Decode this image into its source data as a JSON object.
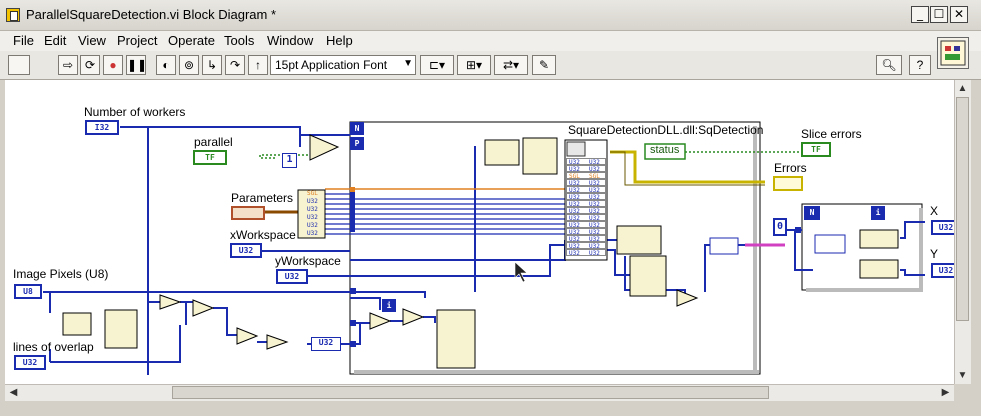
{
  "window": {
    "title": "ParallelSquareDetection.vi Block Diagram *",
    "minimize_glyph": "_",
    "maximize_glyph": "☐",
    "close_glyph": "✕"
  },
  "menu": {
    "items": [
      "File",
      "Edit",
      "View",
      "Project",
      "Operate",
      "Tools",
      "Window",
      "Help"
    ]
  },
  "toolbar": {
    "icons": [
      "run-arrow-icon",
      "run-continuous-icon",
      "abort-icon",
      "pause-icon",
      "highlight-execution-icon",
      "retain-wire-values-icon",
      "step-into-icon",
      "step-over-icon",
      "step-out-icon",
      "align-objects-icon",
      "distribute-objects-icon",
      "reorder-icon",
      "clean-up-diagram-icon",
      "search-icon",
      "context-help-icon"
    ],
    "font_select_value": "15pt Application Font"
  },
  "diagram": {
    "labels": {
      "number_of_workers": "Number of workers",
      "parallel": "parallel",
      "parameters": "Parameters",
      "xworkspace": "xWorkspace",
      "yworkspace": "yWorkspace",
      "image_pixels": "Image Pixels (U8)",
      "lines_of_overlap": "lines of overlap",
      "dll_call": "SquareDetectionDLL.dll:SqDetection",
      "status": "status",
      "slice_errors": "Slice errors",
      "errors": "Errors",
      "x_out": "X",
      "y_out": "Y"
    },
    "terminals": {
      "workers_type": "I32",
      "parallel_type": "TF",
      "parallel_const": "1",
      "xworkspace_type": "U32",
      "yworkspace_type": "U32",
      "image_type": "U8",
      "overlap_type": "U32",
      "to_u32": "U32",
      "slice_errors_type": "TF",
      "x_type": "U32",
      "y_type": "U32",
      "loop_n": "N",
      "loop_p": "P",
      "loop_i": "i",
      "inner_n": "N",
      "inner_i": "i",
      "zero_const": "0"
    },
    "dll_param_types": [
      "U32",
      "U32",
      "SGL",
      "U32",
      "U32",
      "U32",
      "U32",
      "U32",
      "U32",
      "U32",
      "U32",
      "U32",
      "U32",
      "U32"
    ],
    "cluster_types": [
      "SGL",
      "U32",
      "U32",
      "U32",
      "U32",
      "U32"
    ]
  },
  "colors": {
    "wire_integer": "#1b2bb0",
    "wire_boolean": "#2a8a20",
    "wire_float": "#e08020",
    "wire_error": "#c8b400",
    "wire_array": "#d040c0"
  }
}
